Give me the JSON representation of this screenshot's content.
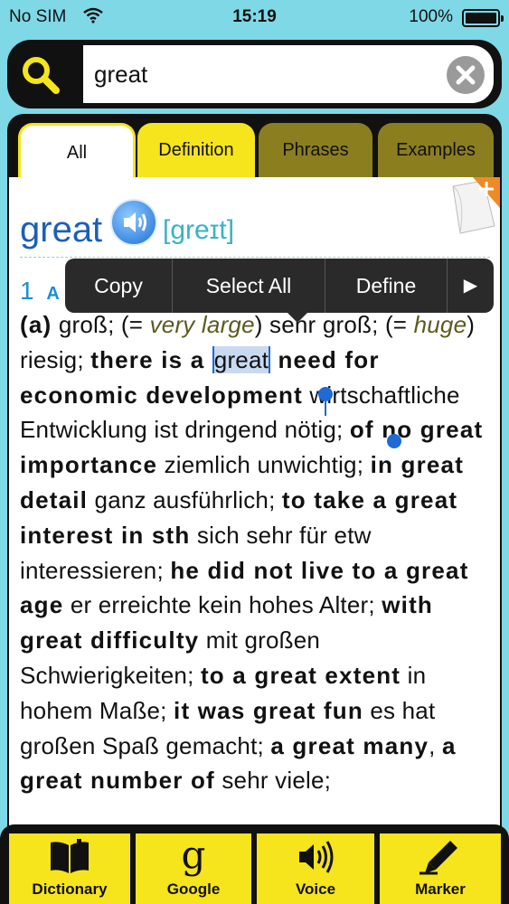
{
  "status_bar": {
    "carrier": "No SIM",
    "time": "15:19",
    "battery": "100%"
  },
  "search": {
    "value": "great",
    "placeholder": ""
  },
  "tabs": [
    {
      "label": "All",
      "active": true
    },
    {
      "label": "Definition",
      "active": false
    },
    {
      "label": "Phrases",
      "active": false
    },
    {
      "label": "Examples",
      "active": false
    }
  ],
  "entry": {
    "headword": "great",
    "pronunciation": "[greɪt]",
    "sense_number": "1",
    "sense_marker": "A",
    "line1_a": "(a)",
    "line1_b": " groß; (= ",
    "very_large": "very large",
    "line1_c": ") sehr groß; (= ",
    "huge": "huge",
    "line2_a": ") riesig; ",
    "ex1a": "there is a ",
    "ex1sel": "great",
    "ex1b": " need for economic development",
    "tr1": " wirtschaftliche Entwicklung ist dringend nötig; ",
    "ex2": "of no great importance",
    "tr2": " ziemlich unwichtig; ",
    "ex3": "in great detail",
    "tr3": " ganz ausführlich; ",
    "ex4": "to take a great interest in sth",
    "tr4": " sich sehr für etw interessieren; ",
    "ex5": "he did not live to a great age",
    "tr5": " er erreichte kein hohes Alter; ",
    "ex6": "with great difficulty",
    "tr6": " mit großen Schwierigkeiten; ",
    "ex7": "to a great extent",
    "tr7": " in hohem Maße; ",
    "ex8": "it was great fun",
    "tr8": " es hat großen Spaß gemacht; ",
    "ex9": "a great many",
    "ex10": "a great number of",
    "tr9": " sehr viele;"
  },
  "context_menu": {
    "copy": "Copy",
    "select_all": "Select All",
    "define": "Define",
    "more": "▶"
  },
  "toolbar": {
    "dictionary": "Dictionary",
    "google": "Google",
    "voice": "Voice",
    "marker": "Marker"
  },
  "colors": {
    "background": "#7fd8e6",
    "accent_yellow": "#f6e41c",
    "tab_olive": "#8b7e1e",
    "headword_blue": "#1b5fb8",
    "selection": "#c8daf0"
  }
}
